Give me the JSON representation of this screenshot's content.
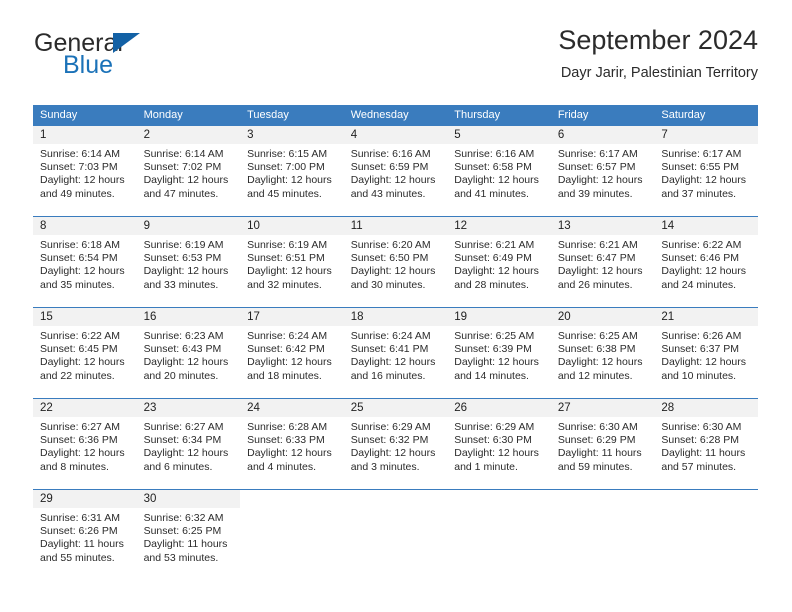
{
  "brand": {
    "name_part1": "General",
    "name_part2": "Blue",
    "logo_icon": "triangle-logo-icon",
    "accent_color": "#1b72b8"
  },
  "header": {
    "title": "September 2024",
    "subtitle": "Dayr Jarir, Palestinian Territory"
  },
  "calendar": {
    "header_bg": "#3a7cbe",
    "daynum_bg": "#f2f2f2",
    "weekday_headers": [
      "Sunday",
      "Monday",
      "Tuesday",
      "Wednesday",
      "Thursday",
      "Friday",
      "Saturday"
    ],
    "weeks": [
      [
        {
          "day": "1",
          "sunrise": "Sunrise: 6:14 AM",
          "sunset": "Sunset: 7:03 PM",
          "daylight_line1": "Daylight: 12 hours",
          "daylight_line2": "and 49 minutes."
        },
        {
          "day": "2",
          "sunrise": "Sunrise: 6:14 AM",
          "sunset": "Sunset: 7:02 PM",
          "daylight_line1": "Daylight: 12 hours",
          "daylight_line2": "and 47 minutes."
        },
        {
          "day": "3",
          "sunrise": "Sunrise: 6:15 AM",
          "sunset": "Sunset: 7:00 PM",
          "daylight_line1": "Daylight: 12 hours",
          "daylight_line2": "and 45 minutes."
        },
        {
          "day": "4",
          "sunrise": "Sunrise: 6:16 AM",
          "sunset": "Sunset: 6:59 PM",
          "daylight_line1": "Daylight: 12 hours",
          "daylight_line2": "and 43 minutes."
        },
        {
          "day": "5",
          "sunrise": "Sunrise: 6:16 AM",
          "sunset": "Sunset: 6:58 PM",
          "daylight_line1": "Daylight: 12 hours",
          "daylight_line2": "and 41 minutes."
        },
        {
          "day": "6",
          "sunrise": "Sunrise: 6:17 AM",
          "sunset": "Sunset: 6:57 PM",
          "daylight_line1": "Daylight: 12 hours",
          "daylight_line2": "and 39 minutes."
        },
        {
          "day": "7",
          "sunrise": "Sunrise: 6:17 AM",
          "sunset": "Sunset: 6:55 PM",
          "daylight_line1": "Daylight: 12 hours",
          "daylight_line2": "and 37 minutes."
        }
      ],
      [
        {
          "day": "8",
          "sunrise": "Sunrise: 6:18 AM",
          "sunset": "Sunset: 6:54 PM",
          "daylight_line1": "Daylight: 12 hours",
          "daylight_line2": "and 35 minutes."
        },
        {
          "day": "9",
          "sunrise": "Sunrise: 6:19 AM",
          "sunset": "Sunset: 6:53 PM",
          "daylight_line1": "Daylight: 12 hours",
          "daylight_line2": "and 33 minutes."
        },
        {
          "day": "10",
          "sunrise": "Sunrise: 6:19 AM",
          "sunset": "Sunset: 6:51 PM",
          "daylight_line1": "Daylight: 12 hours",
          "daylight_line2": "and 32 minutes."
        },
        {
          "day": "11",
          "sunrise": "Sunrise: 6:20 AM",
          "sunset": "Sunset: 6:50 PM",
          "daylight_line1": "Daylight: 12 hours",
          "daylight_line2": "and 30 minutes."
        },
        {
          "day": "12",
          "sunrise": "Sunrise: 6:21 AM",
          "sunset": "Sunset: 6:49 PM",
          "daylight_line1": "Daylight: 12 hours",
          "daylight_line2": "and 28 minutes."
        },
        {
          "day": "13",
          "sunrise": "Sunrise: 6:21 AM",
          "sunset": "Sunset: 6:47 PM",
          "daylight_line1": "Daylight: 12 hours",
          "daylight_line2": "and 26 minutes."
        },
        {
          "day": "14",
          "sunrise": "Sunrise: 6:22 AM",
          "sunset": "Sunset: 6:46 PM",
          "daylight_line1": "Daylight: 12 hours",
          "daylight_line2": "and 24 minutes."
        }
      ],
      [
        {
          "day": "15",
          "sunrise": "Sunrise: 6:22 AM",
          "sunset": "Sunset: 6:45 PM",
          "daylight_line1": "Daylight: 12 hours",
          "daylight_line2": "and 22 minutes."
        },
        {
          "day": "16",
          "sunrise": "Sunrise: 6:23 AM",
          "sunset": "Sunset: 6:43 PM",
          "daylight_line1": "Daylight: 12 hours",
          "daylight_line2": "and 20 minutes."
        },
        {
          "day": "17",
          "sunrise": "Sunrise: 6:24 AM",
          "sunset": "Sunset: 6:42 PM",
          "daylight_line1": "Daylight: 12 hours",
          "daylight_line2": "and 18 minutes."
        },
        {
          "day": "18",
          "sunrise": "Sunrise: 6:24 AM",
          "sunset": "Sunset: 6:41 PM",
          "daylight_line1": "Daylight: 12 hours",
          "daylight_line2": "and 16 minutes."
        },
        {
          "day": "19",
          "sunrise": "Sunrise: 6:25 AM",
          "sunset": "Sunset: 6:39 PM",
          "daylight_line1": "Daylight: 12 hours",
          "daylight_line2": "and 14 minutes."
        },
        {
          "day": "20",
          "sunrise": "Sunrise: 6:25 AM",
          "sunset": "Sunset: 6:38 PM",
          "daylight_line1": "Daylight: 12 hours",
          "daylight_line2": "and 12 minutes."
        },
        {
          "day": "21",
          "sunrise": "Sunrise: 6:26 AM",
          "sunset": "Sunset: 6:37 PM",
          "daylight_line1": "Daylight: 12 hours",
          "daylight_line2": "and 10 minutes."
        }
      ],
      [
        {
          "day": "22",
          "sunrise": "Sunrise: 6:27 AM",
          "sunset": "Sunset: 6:36 PM",
          "daylight_line1": "Daylight: 12 hours",
          "daylight_line2": "and 8 minutes."
        },
        {
          "day": "23",
          "sunrise": "Sunrise: 6:27 AM",
          "sunset": "Sunset: 6:34 PM",
          "daylight_line1": "Daylight: 12 hours",
          "daylight_line2": "and 6 minutes."
        },
        {
          "day": "24",
          "sunrise": "Sunrise: 6:28 AM",
          "sunset": "Sunset: 6:33 PM",
          "daylight_line1": "Daylight: 12 hours",
          "daylight_line2": "and 4 minutes."
        },
        {
          "day": "25",
          "sunrise": "Sunrise: 6:29 AM",
          "sunset": "Sunset: 6:32 PM",
          "daylight_line1": "Daylight: 12 hours",
          "daylight_line2": "and 3 minutes."
        },
        {
          "day": "26",
          "sunrise": "Sunrise: 6:29 AM",
          "sunset": "Sunset: 6:30 PM",
          "daylight_line1": "Daylight: 12 hours",
          "daylight_line2": "and 1 minute."
        },
        {
          "day": "27",
          "sunrise": "Sunrise: 6:30 AM",
          "sunset": "Sunset: 6:29 PM",
          "daylight_line1": "Daylight: 11 hours",
          "daylight_line2": "and 59 minutes."
        },
        {
          "day": "28",
          "sunrise": "Sunrise: 6:30 AM",
          "sunset": "Sunset: 6:28 PM",
          "daylight_line1": "Daylight: 11 hours",
          "daylight_line2": "and 57 minutes."
        }
      ],
      [
        {
          "day": "29",
          "sunrise": "Sunrise: 6:31 AM",
          "sunset": "Sunset: 6:26 PM",
          "daylight_line1": "Daylight: 11 hours",
          "daylight_line2": "and 55 minutes."
        },
        {
          "day": "30",
          "sunrise": "Sunrise: 6:32 AM",
          "sunset": "Sunset: 6:25 PM",
          "daylight_line1": "Daylight: 11 hours",
          "daylight_line2": "and 53 minutes."
        },
        {
          "day": "",
          "sunrise": "",
          "sunset": "",
          "daylight_line1": "",
          "daylight_line2": ""
        },
        {
          "day": "",
          "sunrise": "",
          "sunset": "",
          "daylight_line1": "",
          "daylight_line2": ""
        },
        {
          "day": "",
          "sunrise": "",
          "sunset": "",
          "daylight_line1": "",
          "daylight_line2": ""
        },
        {
          "day": "",
          "sunrise": "",
          "sunset": "",
          "daylight_line1": "",
          "daylight_line2": ""
        },
        {
          "day": "",
          "sunrise": "",
          "sunset": "",
          "daylight_line1": "",
          "daylight_line2": ""
        }
      ]
    ]
  }
}
